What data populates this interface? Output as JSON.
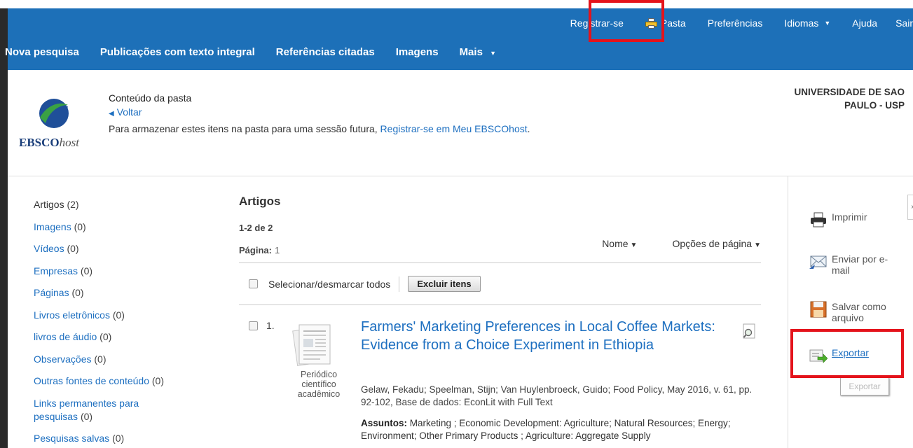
{
  "utility_nav": {
    "register": "Registrar-se",
    "folder": "Pasta",
    "preferences": "Preferências",
    "languages": "Idiomas",
    "help": "Ajuda",
    "exit": "Sair"
  },
  "main_nav": {
    "new_search": "Nova pesquisa",
    "full_text": "Publicações com texto integral",
    "cited_refs": "Referências citadas",
    "images": "Imagens",
    "more": "Mais"
  },
  "header": {
    "logo_text_bold": "EBSCO",
    "logo_text_italic": "host",
    "title": "Conteúdo da pasta",
    "back": "Voltar",
    "store_text": "Para armazenar estes itens na pasta para uma sessão futura, ",
    "store_link": "Registrar-se em Meu EBSCOhost",
    "store_end": ".",
    "institution": "UNIVERSIDADE DE SAO PAULO - USP"
  },
  "sidebar": {
    "items": [
      {
        "label": "Artigos",
        "count": "(2)"
      },
      {
        "label": "Imagens",
        "count": "(0)"
      },
      {
        "label": "Vídeos",
        "count": "(0)"
      },
      {
        "label": "Empresas",
        "count": "(0)"
      },
      {
        "label": "Páginas",
        "count": "(0)"
      },
      {
        "label": "Livros eletrônicos",
        "count": "(0)"
      },
      {
        "label": "livros de áudio",
        "count": "(0)"
      },
      {
        "label": "Observações",
        "count": "(0)"
      },
      {
        "label": "Outras fontes de conteúdo",
        "count": "(0)"
      },
      {
        "label": "Links permanentes para pesquisas",
        "count": "(0)"
      },
      {
        "label": "Pesquisas salvas",
        "count": "(0)"
      }
    ]
  },
  "results": {
    "heading": "Artigos",
    "count": "1-2 de 2",
    "page_label": "Página:",
    "page_num": "1",
    "sort": "Nome",
    "page_options": "Opções de página",
    "select_all": "Selecionar/desmarcar todos",
    "delete_items": "Excluir itens"
  },
  "result1": {
    "number": "1.",
    "type": "Periódico científico acadêmico",
    "title": "Farmers' Marketing Preferences in Local Coffee Markets: Evidence from a Choice Experiment in Ethiopia",
    "citation": "Gelaw, Fekadu; Speelman, Stijn; Van Huylenbroeck, Guido; Food Policy, May 2016, v. 61, pp. 92-102, Base de dados: EconLit with Full Text",
    "subjects_label": "Assuntos:",
    "subjects": "Marketing ; Economic Development: Agriculture; Natural Resources; Energy; Environment; Other Primary Products ; Agriculture: Aggregate Supply"
  },
  "tools": {
    "print": "Imprimir",
    "email": "Enviar por e-mail",
    "save": "Salvar como arquivo",
    "export": "Exportar",
    "export_tooltip": "Exportar"
  },
  "colors": {
    "topbar": "#1d70b8",
    "link": "#1d6fc0",
    "highlight": "#e4131b"
  }
}
